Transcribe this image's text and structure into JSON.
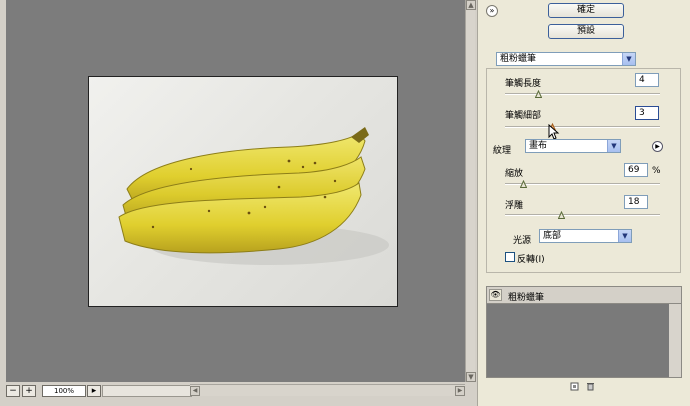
{
  "buttons": {
    "ok": "確定",
    "default": "預設"
  },
  "filter_select": "粗粉蠟筆",
  "stroke_length": {
    "label": "筆觸長度",
    "value": "4",
    "level": 0.2
  },
  "stroke_detail": {
    "label": "筆觸細部",
    "value": "3",
    "level": 0.3
  },
  "texture": {
    "label": "紋理",
    "value": "畫布"
  },
  "scaling": {
    "label": "縮放",
    "value": "69",
    "unit": "%",
    "level": 0.1
  },
  "relief": {
    "label": "浮雕",
    "value": "18",
    "level": 0.36
  },
  "light": {
    "label": "光源",
    "value": "底部"
  },
  "invert": {
    "label": "反轉(I)",
    "checked": false
  },
  "layers": [
    {
      "name": "粗粉蠟筆",
      "visible": true
    }
  ],
  "statusbar": {
    "minus": "−",
    "plus": "+",
    "zoom": "100%"
  },
  "colors": {
    "canvas_bg": "#7c7c7c",
    "panel_bg": "#ece9d8",
    "button_border": "#3b5f9a",
    "banana": "#e3d43a"
  },
  "icons": {
    "collapse": "double-chevron-icon",
    "eye": "eye-icon",
    "new_layer": "new-layer-icon",
    "trash": "trash-icon"
  }
}
